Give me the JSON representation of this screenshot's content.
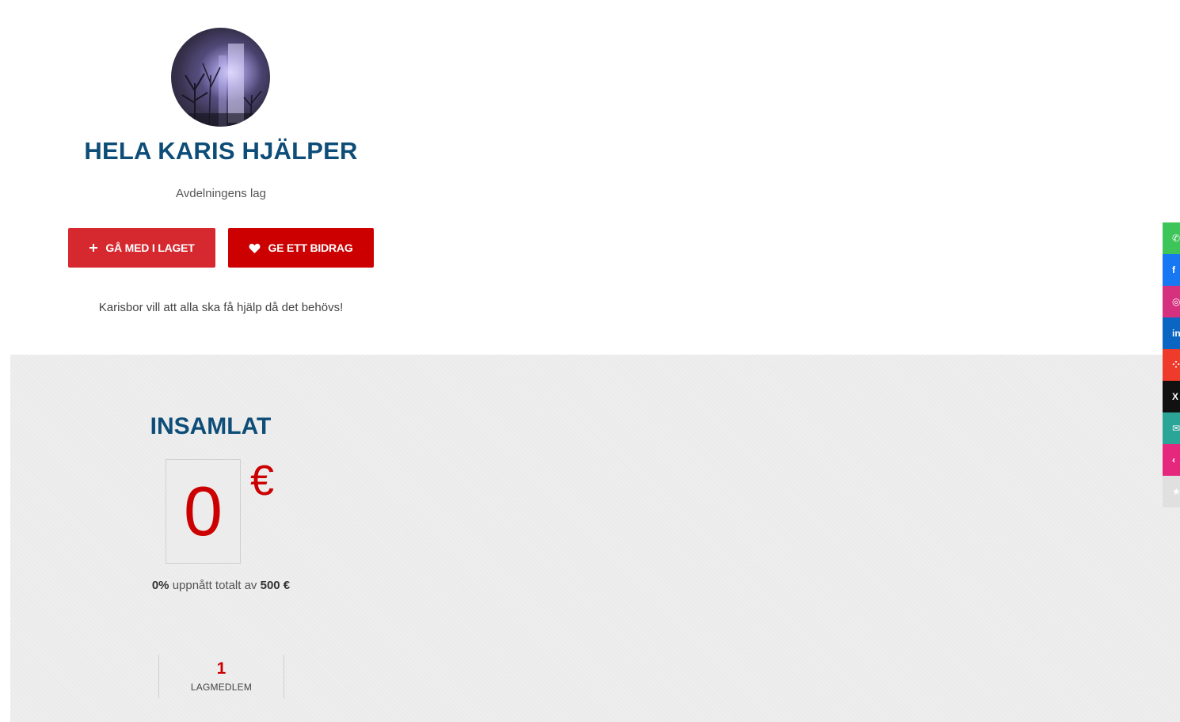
{
  "team": {
    "name": "HELA KARIS HJÄLPER",
    "type": "Avdelningens lag",
    "description": "Karisbor vill att alla ska få hjälp då det behövs!"
  },
  "actions": {
    "join_label": "GÅ MED I LAGET",
    "donate_label": "GE ETT BIDRAG"
  },
  "fundraising": {
    "title": "INSAMLAT",
    "amount": "0",
    "currency": "€",
    "percent": "0%",
    "progress_middle": "uppnått totalt av",
    "goal": "500 €"
  },
  "stats": {
    "members_count": "1",
    "members_label": "LAGMEDLEM"
  },
  "share": [
    {
      "name": "whatsapp-icon",
      "color": "#3ec55a",
      "glyph": "✆"
    },
    {
      "name": "facebook-icon",
      "color": "#1877f2",
      "glyph": "f"
    },
    {
      "name": "instagram-icon",
      "color": "#d6317e",
      "glyph": "◎"
    },
    {
      "name": "linkedin-icon",
      "color": "#0a66c2",
      "glyph": "in"
    },
    {
      "name": "app-icon",
      "color": "#ee3b2b",
      "glyph": "⁘"
    },
    {
      "name": "x-icon",
      "color": "#111111",
      "glyph": "X"
    },
    {
      "name": "email-icon",
      "color": "#2ba597",
      "glyph": "✉"
    },
    {
      "name": "embed-icon",
      "color": "#e5287d",
      "glyph": "‹"
    },
    {
      "name": "star-icon",
      "color": "#e0e0e0",
      "glyph": "★"
    }
  ]
}
